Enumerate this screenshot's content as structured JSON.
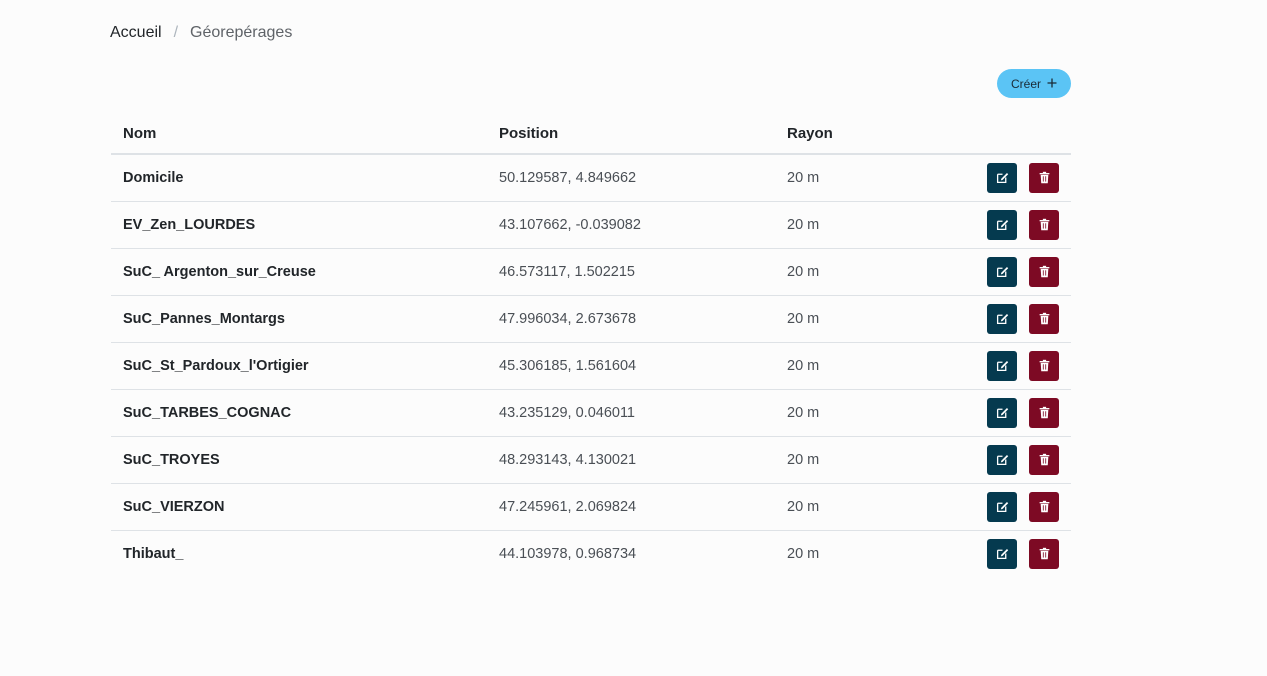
{
  "breadcrumb": {
    "home": "Accueil",
    "separator": "/",
    "current": "Géorepérages"
  },
  "toolbar": {
    "create_label": "Créer",
    "create_icon": "plus-icon"
  },
  "colors": {
    "create_button": "#5bc4f5",
    "edit_button": "#053a4f",
    "delete_button": "#7d0a24"
  },
  "table": {
    "headers": {
      "name": "Nom",
      "position": "Position",
      "radius": "Rayon"
    },
    "rows": [
      {
        "name": "Domicile",
        "position": "50.129587, 4.849662",
        "radius": "20 m"
      },
      {
        "name": "EV_Zen_LOURDES",
        "position": "43.107662, -0.039082",
        "radius": "20 m"
      },
      {
        "name": "SuC_ Argenton_sur_Creuse",
        "position": "46.573117, 1.502215",
        "radius": "20 m"
      },
      {
        "name": "SuC_Pannes_Montargs",
        "position": "47.996034, 2.673678",
        "radius": "20 m"
      },
      {
        "name": "SuC_St_Pardoux_l'Ortigier",
        "position": "45.306185, 1.561604",
        "radius": "20 m"
      },
      {
        "name": "SuC_TARBES_COGNAC",
        "position": "43.235129, 0.046011",
        "radius": "20 m"
      },
      {
        "name": "SuC_TROYES",
        "position": "48.293143, 4.130021",
        "radius": "20 m"
      },
      {
        "name": "SuC_VIERZON",
        "position": "47.245961, 2.069824",
        "radius": "20 m"
      },
      {
        "name": "Thibaut_",
        "position": "44.103978, 0.968734",
        "radius": "20 m"
      }
    ]
  }
}
